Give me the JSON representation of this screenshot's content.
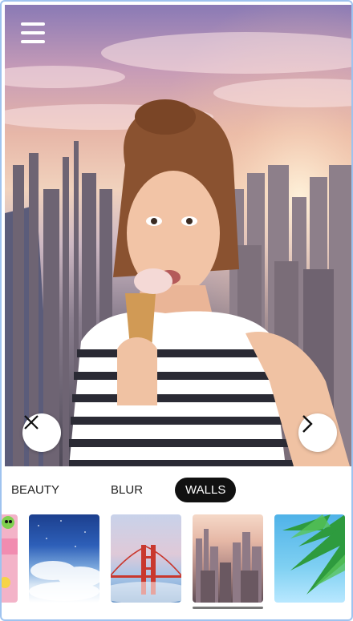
{
  "photo": {
    "description_icon": "photo-editor-canvas"
  },
  "toolbar": {
    "menu_icon": "hamburger-menu-icon",
    "close_icon": "close-icon",
    "next_icon": "chevron-right-icon"
  },
  "tabs": [
    {
      "label": "BEAUTY",
      "selected": false
    },
    {
      "label": "BLUR",
      "selected": false
    },
    {
      "label": "WALLS",
      "selected": true
    }
  ],
  "thumbnails": [
    {
      "name": "sticker-thumb"
    },
    {
      "name": "sky-clouds-thumb"
    },
    {
      "name": "golden-gate-bridge-thumb"
    },
    {
      "name": "city-skyline-thumb",
      "selected": true
    },
    {
      "name": "palm-beach-thumb"
    }
  ],
  "colors": {
    "accent_tab_bg": "#111111",
    "frame_border": "#9fc3ef"
  }
}
